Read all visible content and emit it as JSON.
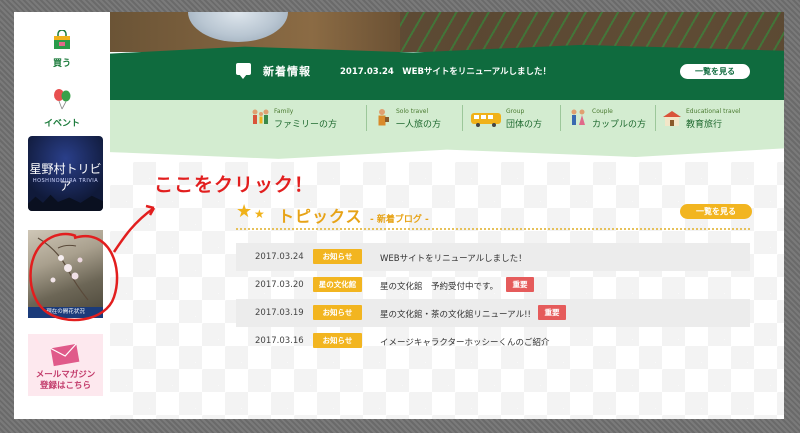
{
  "sidebar": {
    "items": [
      {
        "label": "買う",
        "icon": "shopping-bag-icon"
      },
      {
        "label": "イベント",
        "icon": "balloon-icon"
      }
    ],
    "trivia": {
      "title": "星野村トリビア",
      "subtitle": "HOSHINOMURA TRIVIA"
    },
    "flower_caption": "現在の開花状況",
    "mail_label_line1": "メールマガジン",
    "mail_label_line2": "登録はこちら"
  },
  "news": {
    "title": "新着情報",
    "latest": "2017.03.24　WEBサイトをリニューアルしました！",
    "more_label": "一覧を見る"
  },
  "categories": [
    {
      "en": "Family",
      "jp": "ファミリーの方",
      "icon": "family-icon"
    },
    {
      "en": "Solo travel",
      "jp": "一人旅の方",
      "icon": "solo-traveler-icon"
    },
    {
      "en": "Group",
      "jp": "団体の方",
      "icon": "bus-icon"
    },
    {
      "en": "Couple",
      "jp": "カップルの方",
      "icon": "couple-icon"
    },
    {
      "en": "Educational travel",
      "jp": "教育旅行",
      "icon": "school-icon"
    }
  ],
  "annotation": "ここをクリック！",
  "topics": {
    "title": "トピックス",
    "subtitle": "- 新着ブログ -",
    "more_label": "一覧を見る",
    "rows": [
      {
        "date": "2017.03.24",
        "tag": "お知らせ",
        "text": "WEBサイトをリニューアルしました！",
        "important": ""
      },
      {
        "date": "2017.03.20",
        "tag": "星の文化館",
        "text": "星の文化館　予約受付中です。",
        "important": "重要"
      },
      {
        "date": "2017.03.19",
        "tag": "お知らせ",
        "text": "星の文化館・茶の文化館リニューアル!!",
        "important": "重要"
      },
      {
        "date": "2017.03.16",
        "tag": "お知らせ",
        "text": "イメージキャラクターホッシーくんのご紹介",
        "important": ""
      }
    ]
  },
  "colors": {
    "green_dark": "#0f6b3e",
    "green_light": "#d3ecd0",
    "accent_yellow": "#f2b520",
    "important_red": "#e55b5b",
    "annotation_red": "#e21e1e"
  }
}
